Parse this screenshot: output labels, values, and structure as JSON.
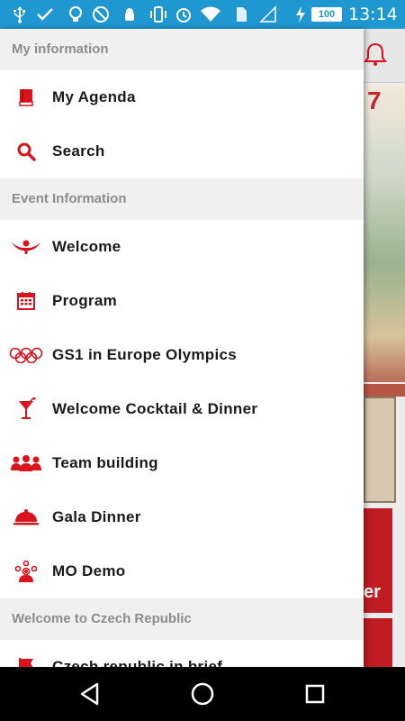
{
  "status_bar": {
    "battery": "100",
    "time": "13:14",
    "icons": [
      "usb-icon",
      "check-icon",
      "lightbulb-icon",
      "no-sim-icon",
      "android-icon",
      "vibrate-icon",
      "alarm-icon",
      "wifi-icon",
      "sim-icon",
      "no-signal-icon",
      "charging-icon"
    ],
    "color": "#1f97d1"
  },
  "drawer": {
    "sections": {
      "my_information": "My information",
      "event_information": "Event Information",
      "welcome_cz": "Welcome to Czech Republic"
    },
    "items": {
      "my_agenda": "My Agenda",
      "search": "Search",
      "welcome": "Welcome",
      "program": "Program",
      "olympics": "GS1 in Europe Olympics",
      "cocktail": "Welcome Cocktail & Dinner",
      "team_building": "Team building",
      "gala_dinner": "Gala Dinner",
      "mo_demo": "MO Demo",
      "czech_brief": "Czech republic in brief"
    },
    "accent_color": "#d9141c"
  },
  "background": {
    "banner_text": "7",
    "card_text": "er"
  },
  "nav_bar": {
    "icons": [
      "back-icon",
      "home-icon",
      "recents-icon"
    ]
  }
}
